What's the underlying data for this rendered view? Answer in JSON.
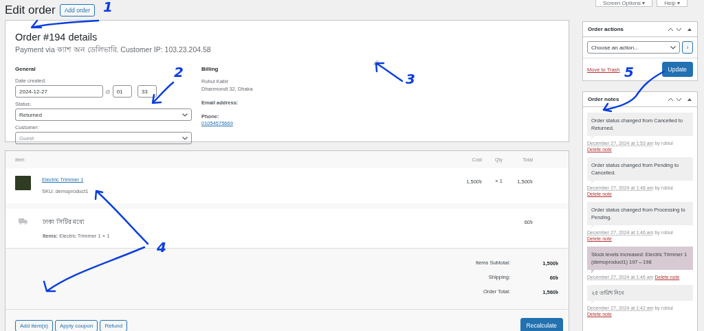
{
  "top_tabs": [
    {
      "label": "Screen Options ▾"
    },
    {
      "label": "Help ▾"
    }
  ],
  "page": {
    "title": "Edit order",
    "add_button": "Add order"
  },
  "order": {
    "heading": "Order #194 details",
    "meta": "Payment via ক্যাশ অন ডেলিভারি. Customer IP: 103.23.204.58"
  },
  "general": {
    "heading": "General",
    "date_label": "Date created:",
    "date": "2024-12-27",
    "at": "@",
    "hour": "01",
    "colon": ":",
    "minute": "33",
    "status_label": "Status:",
    "status": "Returned",
    "customer_label": "Customer:",
    "customer_placeholder": "Guest"
  },
  "billing": {
    "heading": "Billing",
    "name": "Ruhul Kabir",
    "address": "Dhanmondi 32, Dhaka",
    "email_label": "Email address:",
    "phone_label": "Phone:",
    "phone": "01054575669"
  },
  "items_table": {
    "columns": [
      "Item",
      "Cost",
      "Qty",
      "Total"
    ],
    "product": {
      "name": "Electric Trimmer 1",
      "sku": "SKU: demoproduct1",
      "cost": "1,500৳",
      "qty": "× 1",
      "total": "1,500৳"
    },
    "shipping": {
      "name": "ঢাকা সিটির মধ্যে",
      "items_label": "Items:",
      "items": "Electric Trimmer 1 × 1",
      "total": "60৳"
    },
    "totals": [
      {
        "label": "Items Subtotal:",
        "value": "1,500৳"
      },
      {
        "label": "Shipping:",
        "value": "60৳"
      },
      {
        "label": "Order Total:",
        "value": "1,560৳"
      }
    ],
    "buttons": [
      "Add item(s)",
      "Apply coupon",
      "Refund"
    ],
    "primary_button": "Recalculate"
  },
  "order_actions": {
    "title": "Order actions",
    "select": "Choose an action...",
    "go": "›",
    "trash": "Move to Trash",
    "update": "Update"
  },
  "order_notes": {
    "title": "Order notes",
    "notes": [
      {
        "kind": "system",
        "text": "Order status changed from Cancelled to Returned.",
        "date": "December 27, 2024 at 1:53 am",
        "by": "by robiul",
        "delete": "Delete note"
      },
      {
        "kind": "system",
        "text": "Order status changed from Pending to Cancelled.",
        "date": "December 27, 2024 at 1:48 am",
        "by": "by robiul",
        "delete": "Delete note"
      },
      {
        "kind": "system",
        "text": "Order status changed from Processing to Pending.",
        "date": "December 27, 2024 at 1:46 am",
        "by": "by robiul",
        "delete": "Delete note"
      },
      {
        "kind": "customer",
        "text": "Stock levels increased: Electric Trimmer 1 (demoproduct1) 197→198",
        "date": "December 27, 2024 at 1:46 am",
        "delete": "Delete note"
      },
      {
        "kind": "system",
        "text": "২৫ তারিখ নিবে",
        "date": "December 27, 2024 at 1:42 am",
        "by": "by robiul",
        "delete": "Delete note"
      }
    ]
  },
  "annotations": [
    {
      "label": "1"
    },
    {
      "label": "2"
    },
    {
      "label": "3"
    },
    {
      "label": "4"
    },
    {
      "label": "5"
    }
  ]
}
